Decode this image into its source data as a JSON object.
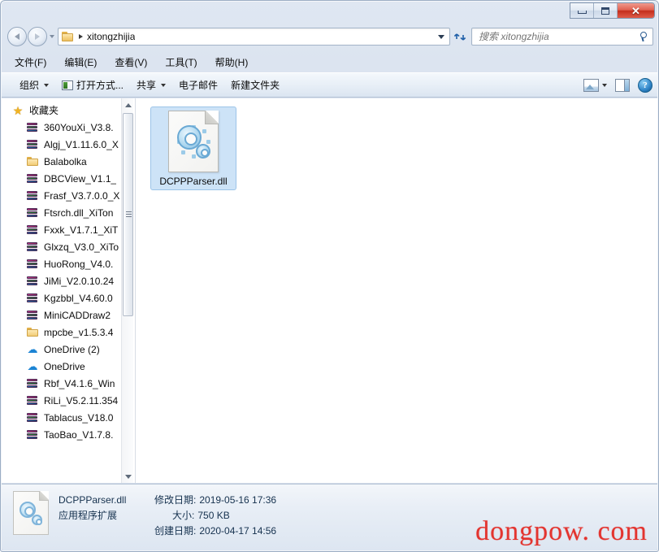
{
  "window": {
    "controls": {
      "minimize_label": "–",
      "maximize_label": "□",
      "close_label": "✕"
    }
  },
  "address_bar": {
    "back_tooltip": "后退",
    "forward_tooltip": "前进",
    "path_text": "xitongzhijia",
    "refresh_label": "↺"
  },
  "search": {
    "placeholder": "搜索 xitongzhijia",
    "value": ""
  },
  "menu": {
    "items": [
      {
        "label": "文件(F)"
      },
      {
        "label": "编辑(E)"
      },
      {
        "label": "查看(V)"
      },
      {
        "label": "工具(T)"
      },
      {
        "label": "帮助(H)"
      }
    ]
  },
  "toolbar": {
    "organize_label": "组织",
    "open_with_label": "打开方式...",
    "share_label": "共享",
    "email_label": "电子邮件",
    "new_folder_label": "新建文件夹",
    "help_label": "?"
  },
  "sidebar": {
    "header": {
      "label": "收藏夹",
      "icon": "star-icon"
    },
    "items": [
      {
        "label": "360YouXi_V3.8.",
        "icon": "rar-archive-icon"
      },
      {
        "label": "Algj_V1.11.6.0_X",
        "icon": "rar-archive-icon"
      },
      {
        "label": "Balabolka",
        "icon": "folder-icon"
      },
      {
        "label": "DBCView_V1.1_",
        "icon": "rar-archive-icon"
      },
      {
        "label": "Frasf_V3.7.0.0_X",
        "icon": "rar-archive-icon"
      },
      {
        "label": "Ftsrch.dll_XiTon",
        "icon": "rar-archive-icon"
      },
      {
        "label": "Fxxk_V1.7.1_XiT",
        "icon": "rar-archive-icon"
      },
      {
        "label": "Glxzq_V3.0_XiTo",
        "icon": "rar-archive-icon"
      },
      {
        "label": "HuoRong_V4.0.",
        "icon": "rar-archive-icon"
      },
      {
        "label": "JiMi_V2.0.10.24",
        "icon": "rar-archive-icon"
      },
      {
        "label": "Kgzbbl_V4.60.0",
        "icon": "rar-archive-icon"
      },
      {
        "label": "MiniCADDraw2",
        "icon": "rar-archive-icon"
      },
      {
        "label": "mpcbe_v1.5.3.4",
        "icon": "folder-icon"
      },
      {
        "label": "OneDrive (2)",
        "icon": "onedrive-cloud-icon"
      },
      {
        "label": "OneDrive",
        "icon": "onedrive-cloud-icon"
      },
      {
        "label": "Rbf_V4.1.6_Win",
        "icon": "rar-archive-icon"
      },
      {
        "label": "RiLi_V5.2.11.354",
        "icon": "rar-archive-icon"
      },
      {
        "label": "Tablacus_V18.0",
        "icon": "rar-archive-icon"
      },
      {
        "label": "TaoBao_V1.7.8.",
        "icon": "rar-archive-icon"
      }
    ]
  },
  "content": {
    "files": [
      {
        "name": "DCPPParser.dll",
        "icon": "dll-gears-icon",
        "selected": true
      }
    ]
  },
  "status_bar": {
    "file_name": "DCPPParser.dll",
    "file_type": "应用程序扩展",
    "modified_label": "修改日期:",
    "modified_value": "2019-05-16 17:36",
    "size_label": "大小:",
    "size_value": "750 KB",
    "created_label": "创建日期:",
    "created_value": "2020-04-17 14:56"
  },
  "watermark": {
    "text": "dongpow. com",
    "color": "#e3342f"
  }
}
